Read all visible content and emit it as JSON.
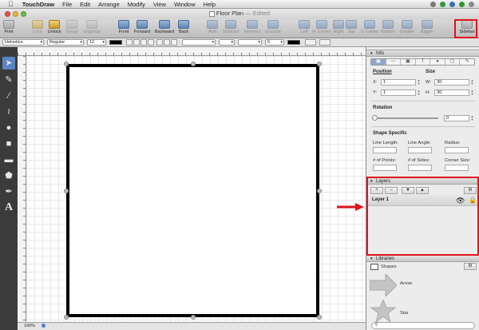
{
  "menubar": {
    "app_name": "TouchDraw",
    "items": [
      "File",
      "Edit",
      "Arrange",
      "Modify",
      "View",
      "Window",
      "Help"
    ]
  },
  "window": {
    "title": "Floor Plan",
    "title_status": "— Edited"
  },
  "toolbar": {
    "print": "Print",
    "lock": "Lock",
    "unlock": "Unlock",
    "group": "Group",
    "ungroup": "Ungroup",
    "front": "Front",
    "forward": "Forward",
    "backward": "Backward",
    "back": "Back",
    "add": "Add",
    "subtract": "Subtract",
    "intersect": "Intersect",
    "exclude": "Exclude",
    "left": "Left",
    "h_center": "H. Center",
    "right": "Right",
    "top": "Top",
    "v_center": "V. Center",
    "bottom": "Bottom",
    "smaller": "Smaller",
    "bigger": "Bigger",
    "sidebar": "Sidebar"
  },
  "format_bar": {
    "font_family": "Helvetica",
    "font_style": "Regular",
    "font_size": "12",
    "stroke_width": "6"
  },
  "status": {
    "zoom": "100%"
  },
  "info": {
    "header": "Info",
    "position_label": "Position",
    "size_label": "Size",
    "x_label": "X:",
    "x_value": "1",
    "y_label": "Y:",
    "y_value": "1",
    "w_label": "W:",
    "w_value": "30",
    "h_label": "H:",
    "h_value": "30",
    "rotation_label": "Rotation",
    "rotation_value": "0",
    "shape_specific_label": "Shape Specific",
    "line_length_label": "Line Length:",
    "line_angle_label": "Line Angle:",
    "radius_label": "Radius:",
    "points_label": "# of Points:",
    "sides_label": "# of Sides:",
    "corner_size_label": "Corner Size:"
  },
  "layers": {
    "header": "Layers",
    "add": "+",
    "remove": "−",
    "items": [
      {
        "name": "Layer 1"
      }
    ]
  },
  "libraries": {
    "header": "Libraries",
    "selected": "Shapes",
    "items": [
      {
        "name": "Arrow"
      },
      {
        "name": "Star"
      }
    ]
  },
  "colors": {
    "highlight": "#e0141c",
    "accent": "#5a84c4"
  }
}
